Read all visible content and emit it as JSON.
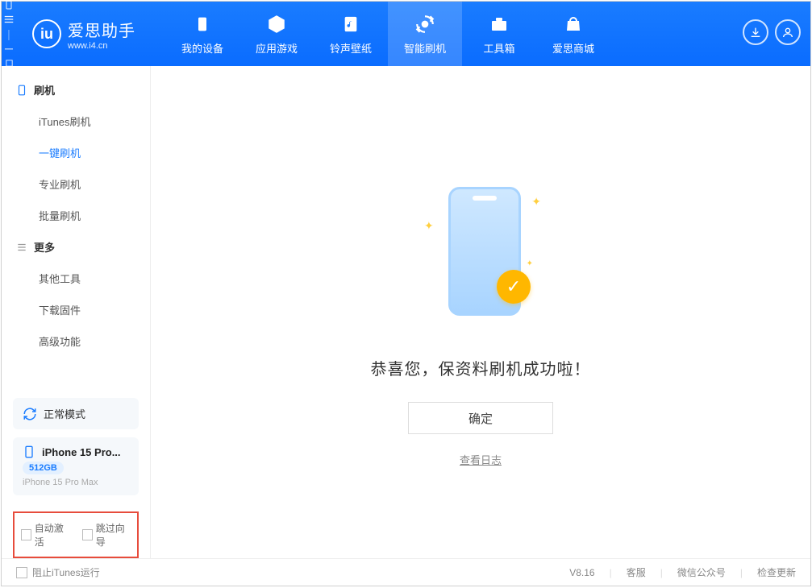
{
  "app": {
    "name": "爱思助手",
    "url": "www.i4.cn"
  },
  "nav": [
    {
      "label": "我的设备"
    },
    {
      "label": "应用游戏"
    },
    {
      "label": "铃声壁纸"
    },
    {
      "label": "智能刷机"
    },
    {
      "label": "工具箱"
    },
    {
      "label": "爱思商城"
    }
  ],
  "sidebar": {
    "group1": {
      "title": "刷机",
      "items": [
        "iTunes刷机",
        "一键刷机",
        "专业刷机",
        "批量刷机"
      ]
    },
    "group2": {
      "title": "更多",
      "items": [
        "其他工具",
        "下载固件",
        "高级功能"
      ]
    }
  },
  "mode": {
    "label": "正常模式"
  },
  "device": {
    "name": "iPhone 15 Pro...",
    "storage": "512GB",
    "full": "iPhone 15 Pro Max"
  },
  "options": {
    "auto_activate": "自动激活",
    "skip_wizard": "跳过向导"
  },
  "main": {
    "success": "恭喜您，保资料刷机成功啦！",
    "ok": "确定",
    "view_log": "查看日志"
  },
  "footer": {
    "block_itunes": "阻止iTunes运行",
    "version": "V8.16",
    "support": "客服",
    "wechat": "微信公众号",
    "update": "检查更新"
  }
}
